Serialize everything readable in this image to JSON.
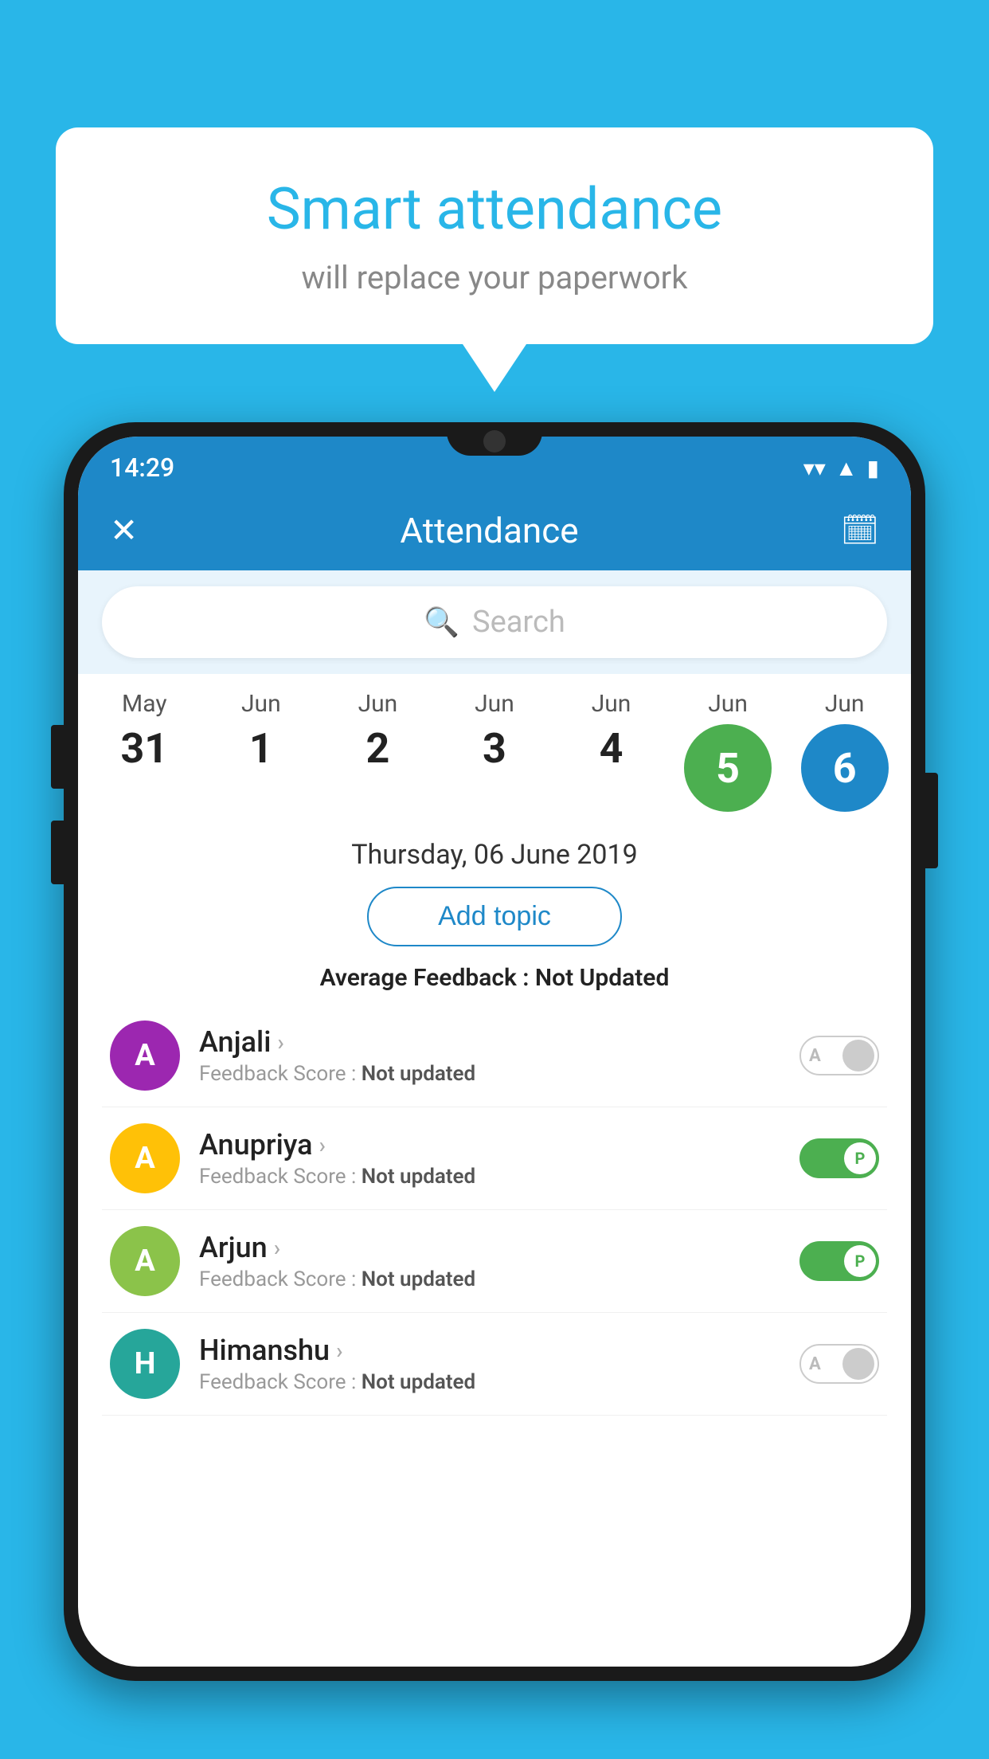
{
  "background_color": "#29b6e8",
  "speech_bubble": {
    "title": "Smart attendance",
    "subtitle": "will replace your paperwork"
  },
  "status_bar": {
    "time": "14:29",
    "wifi_icon": "▼",
    "signal_icon": "▲",
    "battery_icon": "▮"
  },
  "header": {
    "close_label": "✕",
    "title": "Attendance",
    "calendar_icon": "📅"
  },
  "search": {
    "placeholder": "Search"
  },
  "calendar": {
    "dates": [
      {
        "month": "May",
        "day": "31",
        "type": "normal"
      },
      {
        "month": "Jun",
        "day": "1",
        "type": "normal"
      },
      {
        "month": "Jun",
        "day": "2",
        "type": "normal"
      },
      {
        "month": "Jun",
        "day": "3",
        "type": "normal"
      },
      {
        "month": "Jun",
        "day": "4",
        "type": "normal"
      },
      {
        "month": "Jun",
        "day": "5",
        "type": "green"
      },
      {
        "month": "Jun",
        "day": "6",
        "type": "blue"
      }
    ]
  },
  "selected_date": "Thursday, 06 June 2019",
  "add_topic_button": "Add topic",
  "avg_feedback_label": "Average Feedback : ",
  "avg_feedback_value": "Not Updated",
  "students": [
    {
      "name": "Anjali",
      "avatar_letter": "A",
      "avatar_color": "purple",
      "feedback_label": "Feedback Score : ",
      "feedback_value": "Not updated",
      "toggle": "absent"
    },
    {
      "name": "Anupriya",
      "avatar_letter": "A",
      "avatar_color": "yellow",
      "feedback_label": "Feedback Score : ",
      "feedback_value": "Not updated",
      "toggle": "present"
    },
    {
      "name": "Arjun",
      "avatar_letter": "A",
      "avatar_color": "lightgreen",
      "feedback_label": "Feedback Score : ",
      "feedback_value": "Not updated",
      "toggle": "present"
    },
    {
      "name": "Himanshu",
      "avatar_letter": "H",
      "avatar_color": "teal",
      "feedback_label": "Feedback Score : ",
      "feedback_value": "Not updated",
      "toggle": "absent"
    }
  ]
}
